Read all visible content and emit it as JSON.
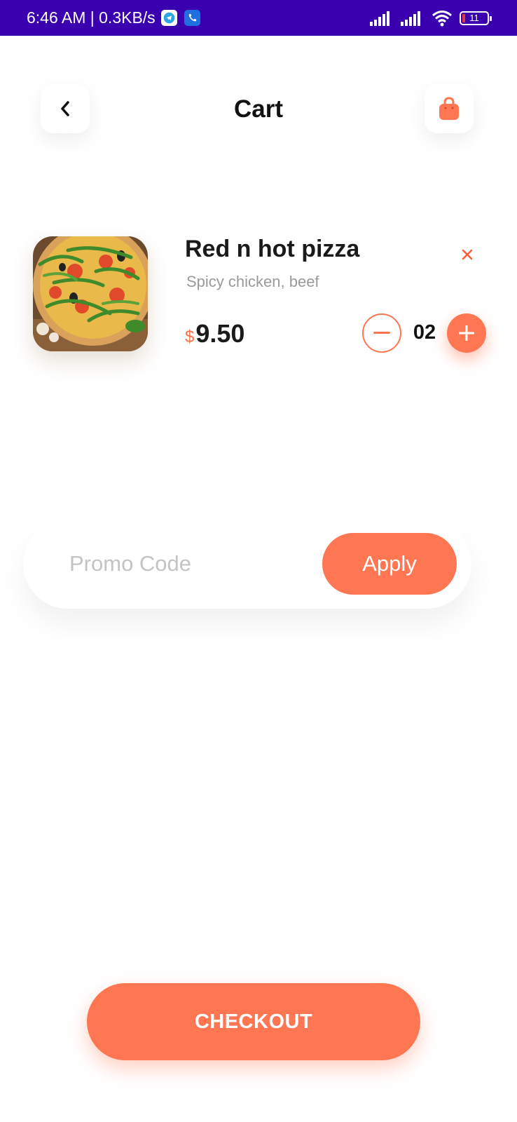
{
  "status_bar": {
    "time_speed": "6:46 AM | 0.3KB/s",
    "battery": "11",
    "icons": [
      "telegram-icon",
      "call-app-icon",
      "signal-icon",
      "signal-icon",
      "wifi-icon",
      "battery-icon"
    ]
  },
  "header": {
    "title": "Cart",
    "back_icon": "chevron-left-icon",
    "bag_icon": "shopping-bag-icon"
  },
  "cart_item": {
    "name": "Red n hot pizza",
    "description": "Spicy chicken, beef",
    "currency": "$",
    "price": "9.50",
    "quantity": "02",
    "remove_icon": "close-icon",
    "minus_icon": "minus-icon",
    "plus_icon": "plus-icon",
    "image": "pizza-image"
  },
  "promo": {
    "placeholder": "Promo Code",
    "apply_label": "Apply"
  },
  "checkout": {
    "label": "CHECKOUT"
  },
  "colors": {
    "accent": "#ff7752",
    "status_bar": "#3a00b0",
    "title_text": "#111111",
    "muted_text": "#9a9a9a"
  }
}
